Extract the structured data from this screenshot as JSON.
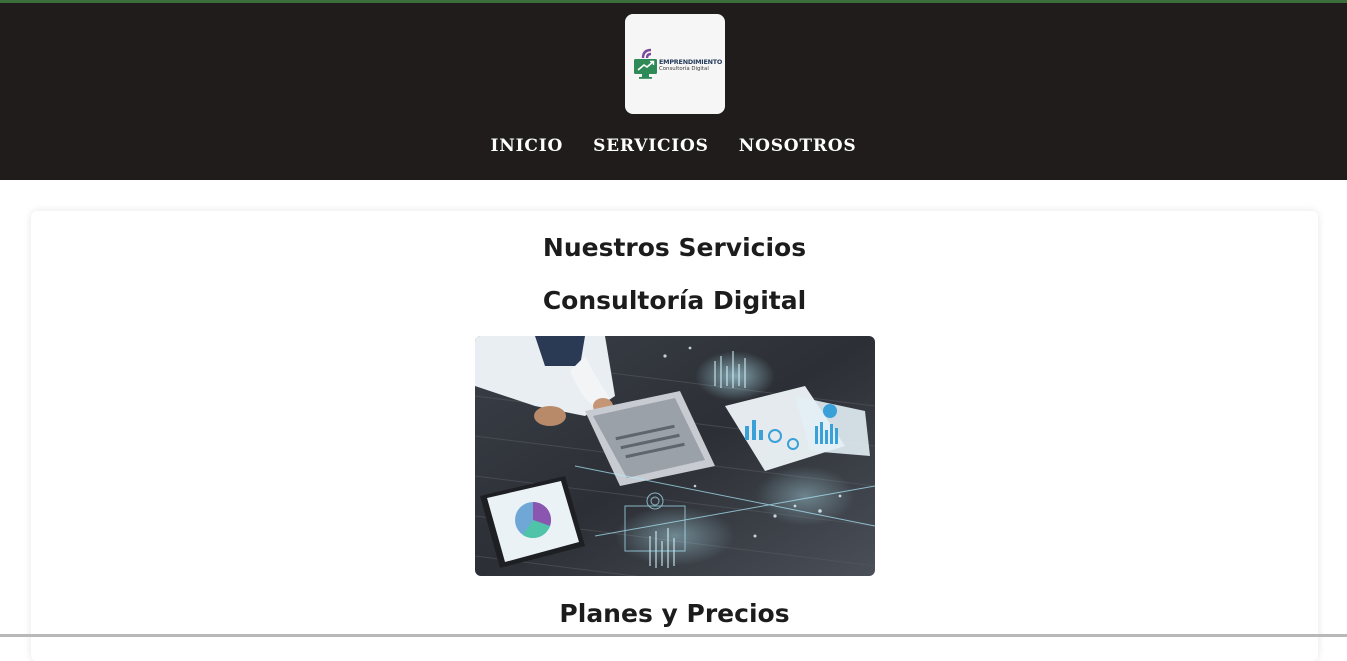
{
  "brand": {
    "logo_line1": "EMPRENDIMIENTO",
    "logo_line2": "Consultoría Digital"
  },
  "nav": {
    "items": [
      {
        "label": "INICIO"
      },
      {
        "label": "SERVICIOS"
      },
      {
        "label": "NOSOTROS"
      }
    ]
  },
  "main": {
    "title": "Nuestros Servicios",
    "service_title": "Consultoría Digital",
    "pricing_title": "Planes y Precios"
  },
  "colors": {
    "header_bg": "#201c1b",
    "top_strip": "#3c6e3c",
    "nav_text": "#ffffff",
    "heading_text": "#1c1c1c"
  },
  "icons": [
    "monitor-growth-icon",
    "signal-waves-icon"
  ]
}
